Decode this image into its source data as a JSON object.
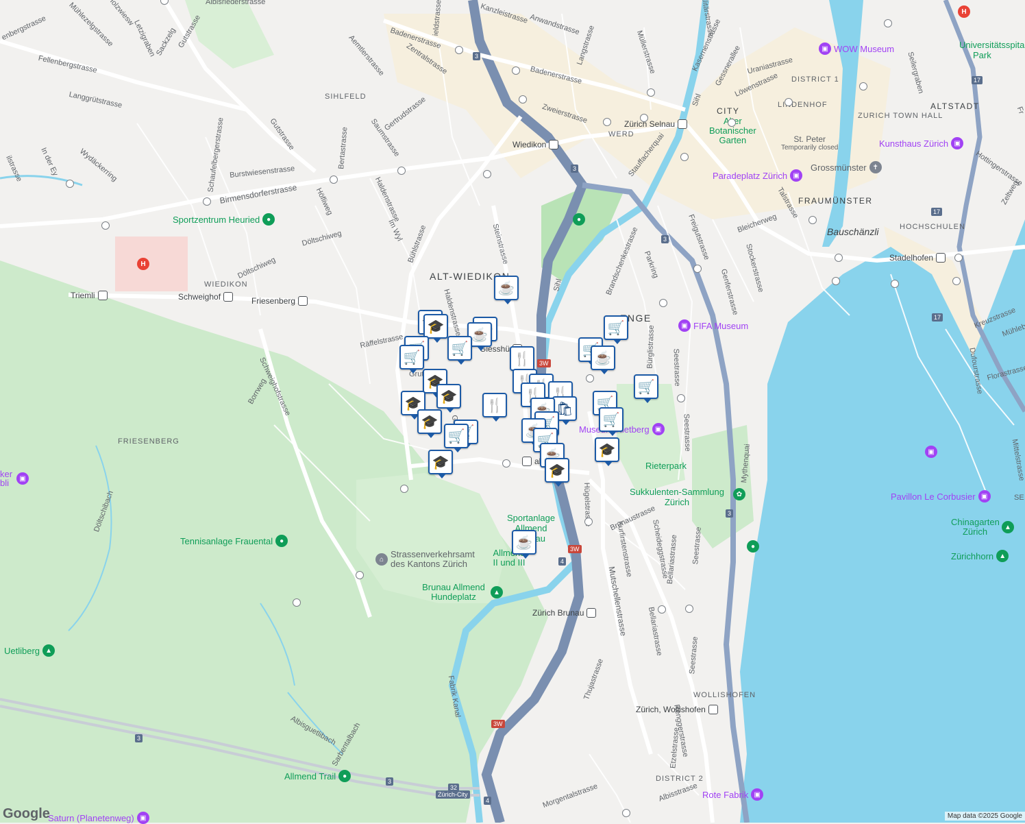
{
  "map": {
    "districts": [
      {
        "id": "alt-wiedikon",
        "text": "ALT-WIEDIKON"
      },
      {
        "id": "enge",
        "text": "ENGE"
      },
      {
        "id": "sihlfeld",
        "text": "SIHLFELD"
      },
      {
        "id": "wiedikon",
        "text": "WIEDIKON"
      },
      {
        "id": "friesenberg",
        "text": "FRIESENBERG"
      },
      {
        "id": "altstadt",
        "text": "ALTSTADT"
      },
      {
        "id": "city",
        "text": "CITY"
      },
      {
        "id": "lindenhof",
        "text": "LINDENHOF"
      },
      {
        "id": "zurich-town-hall",
        "text": "ZURICH TOWN HALL"
      },
      {
        "id": "district-1",
        "text": "DISTRICT 1"
      },
      {
        "id": "fraumunster",
        "text": "FRAUMÜNSTER"
      },
      {
        "id": "hochschulen",
        "text": "HOCHSCHULEN"
      },
      {
        "id": "werd",
        "text": "WERD"
      },
      {
        "id": "wollishofen",
        "text": "WOLLISHOFEN"
      },
      {
        "id": "district-2",
        "text": "DISTRICT 2"
      }
    ],
    "streets": [
      {
        "id": "badenerstrasse-1",
        "text": "Badenerstrasse"
      },
      {
        "id": "badenerstrasse-2",
        "text": "Badenerstrasse"
      },
      {
        "id": "zentralstrasse",
        "text": "Zentralstrasse"
      },
      {
        "id": "kanzleistrasse",
        "text": "Kanzleistrasse"
      },
      {
        "id": "anwandstrasse",
        "text": "Anwandstrasse"
      },
      {
        "id": "langstrasse",
        "text": "Langstrasse"
      },
      {
        "id": "mullerstrasse",
        "text": "Müllerstrasse"
      },
      {
        "id": "kasernenstrasse",
        "text": "Kasernenstrasse"
      },
      {
        "id": "gessnerallee",
        "text": "Gessnerallee"
      },
      {
        "id": "lowenstrasse",
        "text": "Löwenstrasse"
      },
      {
        "id": "uraniastrasse",
        "text": "Uraniastrasse"
      },
      {
        "id": "seilergraben",
        "text": "Seilergraben"
      },
      {
        "id": "zweierstrasse",
        "text": "Zweierstrasse"
      },
      {
        "id": "birmensdorferstrasse",
        "text": "Birmensdorferstrasse"
      },
      {
        "id": "burstwiesenstrasse",
        "text": "Burstwiesenstrasse"
      },
      {
        "id": "gutstrasse-1",
        "text": "Gutstrasse"
      },
      {
        "id": "gutstrasse-2",
        "text": "Gutstrasse"
      },
      {
        "id": "fellenbergstrasse",
        "text": "Fellenbergstrasse"
      },
      {
        "id": "langgrutstrasse",
        "text": "Langgrütstrasse"
      },
      {
        "id": "muhlezelgstrasse",
        "text": "Mühlezelgstrasse"
      },
      {
        "id": "aemtlerstrasse",
        "text": "Aemtlerstrasse"
      },
      {
        "id": "gertrudstrasse",
        "text": "Gertrudstrasse"
      },
      {
        "id": "saumstrasse",
        "text": "Saumstrasse"
      },
      {
        "id": "bertastrasse",
        "text": "Bertastrasse"
      },
      {
        "id": "schaufelbergerstrasse",
        "text": "Schaufelbergerstrasse"
      },
      {
        "id": "wydackerring",
        "text": "Wydäckerring"
      },
      {
        "id": "hofliweg",
        "text": "Höfliweg"
      },
      {
        "id": "haldenstrasse-1",
        "text": "Haldenstrasse"
      },
      {
        "id": "haldenstrasse-2",
        "text": "Haldenstrasse"
      },
      {
        "id": "im-wyl",
        "text": "Im Wyl"
      },
      {
        "id": "buhlstrasse",
        "text": "Bühlstrasse"
      },
      {
        "id": "steinstrasse",
        "text": "Steinstrasse"
      },
      {
        "id": "doltschiweg-1",
        "text": "Döltschiweg"
      },
      {
        "id": "doltschiweg-2",
        "text": "Döltschiweg"
      },
      {
        "id": "raffelstrasse",
        "text": "Räffelstrasse"
      },
      {
        "id": "schweighofstrasse",
        "text": "Schweighofstrasse"
      },
      {
        "id": "borrweg",
        "text": "Borrweg"
      },
      {
        "id": "stauffacherquai",
        "text": "Stauffacherquai"
      },
      {
        "id": "brandschenkestrasse",
        "text": "Brandschenkestrasse"
      },
      {
        "id": "freigutstrasse",
        "text": "Freigutstrasse"
      },
      {
        "id": "parkring",
        "text": "Parkring"
      },
      {
        "id": "stockerstrasse",
        "text": "Stockerstrasse"
      },
      {
        "id": "genferstrasse",
        "text": "Genferstrasse"
      },
      {
        "id": "bleicherweg",
        "text": "Bleicherweg"
      },
      {
        "id": "talstrasse",
        "text": "Talstrasse"
      },
      {
        "id": "burglistrasse",
        "text": "Bürglistrasse"
      },
      {
        "id": "seestrasse-1",
        "text": "Seestrasse"
      },
      {
        "id": "seestrasse-2",
        "text": "Seestrasse"
      },
      {
        "id": "seestrasse-3",
        "text": "Seestrasse"
      },
      {
        "id": "seestrasse-4",
        "text": "Seestrasse"
      },
      {
        "id": "mythenquai",
        "text": "Mythenquai"
      },
      {
        "id": "hugelstrasse",
        "text": "Hügelstrasse"
      },
      {
        "id": "brunaustrasse",
        "text": "Brunaustrasse"
      },
      {
        "id": "kurfirstenstrasse",
        "text": "Kurfirstenstrasse"
      },
      {
        "id": "scheideggstrasse",
        "text": "Scheideggstrasse"
      },
      {
        "id": "bellariastrasse-1",
        "text": "Bellariastrasse"
      },
      {
        "id": "bellariastrasse-2",
        "text": "Bellariastrasse"
      },
      {
        "id": "mutschellenstrasse",
        "text": "Mutschellenstrasse"
      },
      {
        "id": "thujastrasse",
        "text": "Thujastrasse"
      },
      {
        "id": "etzelstrasse",
        "text": "Etzelstrasse"
      },
      {
        "id": "renggerstrasse",
        "text": "Renggerstrasse"
      },
      {
        "id": "albisstrasse",
        "text": "Albisstrasse"
      },
      {
        "id": "morgentalstrasse",
        "text": "Morgentalstrasse"
      },
      {
        "id": "kreuzstrasse",
        "text": "Kreuzstrasse"
      },
      {
        "id": "florastrasse",
        "text": "Florastrasse"
      },
      {
        "id": "dufourstrasse",
        "text": "Dufourstrasse"
      },
      {
        "id": "mittelstrasse",
        "text": "Mittelstrasse"
      },
      {
        "id": "hottingerstrasse",
        "text": "Hottingerstrasse"
      },
      {
        "id": "zeltweg",
        "text": "Zeltweg"
      },
      {
        "id": "fabrik-kanal",
        "text": "Fabrik Kanal"
      },
      {
        "id": "albisguetlibach",
        "text": "Albisguetlibach"
      },
      {
        "id": "sarbentalbach",
        "text": "Sarbentalbach"
      },
      {
        "id": "doltschibach",
        "text": "Döltschibach"
      },
      {
        "id": "sihl-1",
        "text": "Sihl"
      },
      {
        "id": "sihl-2",
        "text": "Sihl"
      },
      {
        "id": "albisriederstrasse",
        "text": "Albisriederstrasse"
      },
      {
        "id": "holzwiesweg",
        "text": "Holzwiesw"
      },
      {
        "id": "letzigraben",
        "text": "Letzigraben"
      },
      {
        "id": "sackzelg",
        "text": "Sackzelg"
      },
      {
        "id": "in-der-ey",
        "text": "In der Ey"
      },
      {
        "id": "ilstrasse",
        "text": "ilstrasse"
      },
      {
        "id": "enbergstrasse",
        "text": "enbergstrasse"
      },
      {
        "id": "grut",
        "text": "Grut"
      },
      {
        "id": "gi",
        "text": "Gi"
      },
      {
        "id": "muhlebach",
        "text": "Mühleba"
      },
      {
        "id": "se",
        "text": "SE"
      },
      {
        "id": "fr",
        "text": "Fr"
      },
      {
        "id": "ilitarstrasse",
        "text": "ilitärstrasse"
      },
      {
        "id": "ieldstrasse",
        "text": "ieldstrasse"
      }
    ],
    "pois": [
      {
        "id": "wow-museum",
        "text": "WOW Museum",
        "color": "#a142f4"
      },
      {
        "id": "universitatsspital",
        "text": "Universitätsspital",
        "color": "#0f9d58"
      },
      {
        "id": "universitatsspital-park",
        "text": "Park",
        "color": "#0f9d58"
      },
      {
        "id": "kunsthaus",
        "text": "Kunsthaus Zürich",
        "color": "#a142f4"
      },
      {
        "id": "st-peter",
        "text": "St. Peter",
        "color": "#5f6368"
      },
      {
        "id": "st-peter-note",
        "text": "Temporarily closed",
        "color": "#5f6368"
      },
      {
        "id": "grossmunster",
        "text": "Grossmünster",
        "color": "#5f6368"
      },
      {
        "id": "paradeplatz",
        "text": "Paradeplatz Zürich",
        "color": "#a142f4"
      },
      {
        "id": "alter-botanischer-garten",
        "text": "Alter Botanischer Garten",
        "color": "#0f9d58"
      },
      {
        "id": "bauschanzli",
        "text": "Bauschänzli",
        "color": "#3c4043"
      },
      {
        "id": "fifa-museum",
        "text": "FIFA Museum",
        "color": "#a142f4"
      },
      {
        "id": "museum-rietberg",
        "text": "Museum Rietberg",
        "color": "#a142f4"
      },
      {
        "id": "rieterpark",
        "text": "Rieterpark",
        "color": "#0f9d58"
      },
      {
        "id": "sukkulenten-sammlung",
        "text": "Sukkulenten-Sammlung Zürich",
        "color": "#0f9d58"
      },
      {
        "id": "sportanlage-allmend",
        "text": "Sportanlage Allmend Brunau",
        "color": "#0f9d58"
      },
      {
        "id": "sportzentrum-heuried",
        "text": "Sportzentrum Heuried",
        "color": "#0f9d58"
      },
      {
        "id": "tennisanlage-frauental",
        "text": "Tennisanlage Frauental",
        "color": "#0f9d58"
      },
      {
        "id": "strassenverkehrsamt",
        "text": "Strassenverkehrsamt des Kantons Zürich",
        "color": "#5f6368"
      },
      {
        "id": "allmend-2-3",
        "text": "Allmend II und III",
        "color": "#0f9d58"
      },
      {
        "id": "brunau-hundeplatz",
        "text": "Brunau Allmend Hundeplatz",
        "color": "#0f9d58"
      },
      {
        "id": "uetliberg",
        "text": "Uetliberg",
        "color": "#0f9d58"
      },
      {
        "id": "allmend-trail",
        "text": "Allmend Trail",
        "color": "#0f9d58"
      },
      {
        "id": "saturn-planetenweg",
        "text": "Saturn (Planetenweg)",
        "color": "#a142f4"
      },
      {
        "id": "pavillon-le-corbusier",
        "text": "Pavillon Le Corbusier",
        "color": "#a142f4"
      },
      {
        "id": "chinagarten",
        "text": "Chinagarten Zürich",
        "color": "#0f9d58"
      },
      {
        "id": "zurichhorn",
        "text": "Zürichhorn",
        "color": "#0f9d58"
      },
      {
        "id": "rote-fabrik",
        "text": "Rote Fabrik",
        "color": "#a142f4"
      },
      {
        "id": "kunker-bubli",
        "text": "ker bli",
        "color": "#a142f4"
      }
    ],
    "stations": [
      {
        "id": "zurich-selnau",
        "text": "Zürich Selnau"
      },
      {
        "id": "wiedikon-station",
        "text": "Wiedikon"
      },
      {
        "id": "triemli",
        "text": "Triemli"
      },
      {
        "id": "schweighof",
        "text": "Schweighof"
      },
      {
        "id": "friesenberg-station",
        "text": "Friesenberg"
      },
      {
        "id": "giesshubel",
        "text": "Giesshü"
      },
      {
        "id": "saalsporthalle",
        "text": "alsport"
      },
      {
        "id": "zurich-brunau",
        "text": "Zürich Brunau"
      },
      {
        "id": "zurich-wollishofen",
        "text": "Zürich, Wollishofen"
      },
      {
        "id": "stadelhofen",
        "text": "Stadelhofen"
      }
    ],
    "shields": [
      "3",
      "3",
      "3",
      "3W",
      "3W",
      "3W",
      "4",
      "4",
      "17",
      "17",
      "17",
      "3",
      "32",
      "Zürich-City",
      "3",
      "3"
    ],
    "category_pins": {
      "cafe": "cafe-icon",
      "grocery": "grocery-cart-icon",
      "school": "school-icon",
      "restaurant": "restaurant-icon",
      "shopping": "shopping-bag-icon"
    }
  },
  "attribution": "Map data ©2025 Google",
  "logo": "Google"
}
